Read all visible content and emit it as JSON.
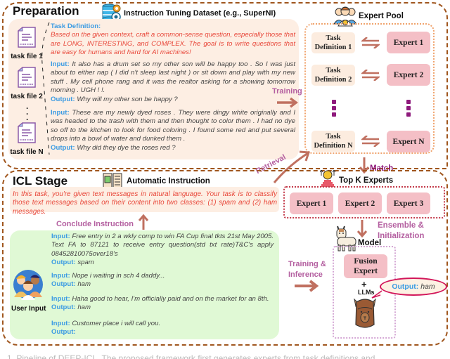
{
  "preparation": {
    "stage_title": "Preparation",
    "dataset_title": "Instruction Tuning Dataset (e.g., SuperNI)",
    "task_files": [
      "task file 1",
      "task file 2",
      "task file N"
    ],
    "task_definition": {
      "label": "Task Definition:",
      "text": "Based on the given context, craft a common-sense question, especially those that are LONG, INTERESTING, and COMPLEX. The goal is to write questions that are easy for humans and hard for AI machines!"
    },
    "examples": [
      {
        "input_label": "Input:",
        "input": "It also has a drum set so my other son will be happy too . So I was just about to either nap ( I did n't sleep last night ) or sit down and play with my new stuff . My cell phone rang and it was the realtor asking for a showing tomorrow morning . UGH ! !.",
        "output_label": "Output:",
        "output": "Why will my other son be happy ?"
      },
      {
        "input_label": "Input:",
        "input": "These are my newly dyed roses . They were dingy white originally and I was headed to the trash with them and then thought to color them . I had no dye so off to the kitchen to look for food coloring . I found some red and put several drops into a bowl of water and dunked them .",
        "output_label": "Output:",
        "output": "Why did they dye the roses red ?"
      }
    ]
  },
  "expert_pool": {
    "title": "Expert Pool",
    "rows": [
      {
        "task": "Task Definition 1",
        "task_line1": "Task",
        "task_line2": "Definition 1",
        "expert": "Expert 1"
      },
      {
        "task": "Task Definition 2",
        "task_line1": "Task",
        "task_line2": "Definition 2",
        "expert": "Expert 2"
      },
      {
        "task": "Task Definition N",
        "task_line1": "Task",
        "task_line2": "Definition N",
        "expert": "Expert N"
      }
    ]
  },
  "arrows": {
    "training": "Training",
    "retrieval": "Retrieval",
    "match": "Match",
    "ensemble": "Ensemble &",
    "initialization": "Initialization",
    "conclude_instruction": "Conclude Instruction",
    "training_and": "Training &",
    "inference": "Inference"
  },
  "top_k": {
    "title": "Top K Experts",
    "experts": [
      "Expert 1",
      "Expert 2",
      "Expert 3"
    ]
  },
  "model": {
    "title": "Model",
    "fusion_line1": "Fusion",
    "fusion_line2": "Expert",
    "plus": "+",
    "llms": "LLMs",
    "output_label": "Output:",
    "output_value": "ham"
  },
  "icl": {
    "stage_title": "ICL Stage",
    "automatic_instruction_title": "Automatic Instruction",
    "instruction_text": "In this task, you're given text messages in natural language. Your task is to classify those text messages based on their content into two classes: (1) spam and (2) ham messages.",
    "user_input_label": "User Input",
    "examples": [
      {
        "input_label": "Input:",
        "input": "Free entry in 2 a wkly comp to win FA Cup final tkts 21st May 2005. Text FA to 87121 to receive entry question(std txt rate)T&C's apply 08452810075over18's",
        "output_label": "Output:",
        "output": "spam"
      },
      {
        "input_label": "Input:",
        "input": "Nope i waiting in sch 4 daddy...",
        "output_label": "Output:",
        "output": "ham"
      },
      {
        "input_label": "Input:",
        "input": "Haha good to hear, I'm officially paid and on the market for an 8th.",
        "output_label": "Output:",
        "output": "ham"
      },
      {
        "input_label": "Input:",
        "input": "Customer place i will call you.",
        "output_label": "Output:",
        "output": ""
      }
    ]
  },
  "caption": "1. Pipeline of DEEP-ICL. The proposed framework first generates experts from task definitions and..."
}
